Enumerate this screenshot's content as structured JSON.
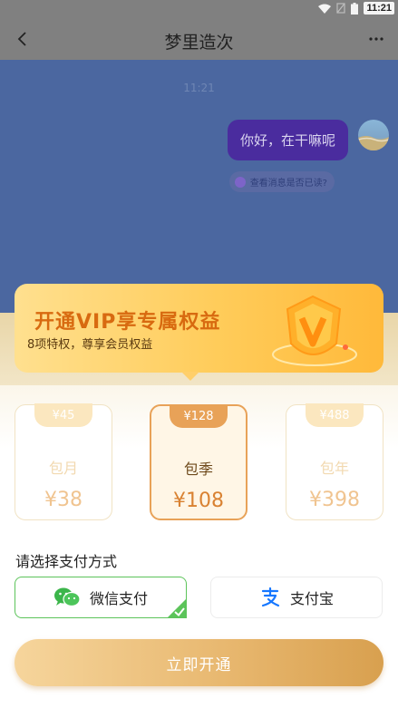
{
  "status_bar": {
    "time": "11:21"
  },
  "header": {
    "title": "梦里造次"
  },
  "chat": {
    "time_label": "11:21",
    "message": "你好，在干嘛呢",
    "read_check_label": "查看消息是否已读?"
  },
  "vip": {
    "title": "开通VIP享专属权益",
    "subtitle": "8项特权，尊享会员权益"
  },
  "plans": [
    {
      "original_price": "¥45",
      "name": "包月",
      "price": "¥38",
      "selected": false
    },
    {
      "original_price": "¥128",
      "name": "包季",
      "price": "¥108",
      "selected": true
    },
    {
      "original_price": "¥488",
      "name": "包年",
      "price": "¥398",
      "selected": false
    }
  ],
  "payment": {
    "label": "请选择支付方式",
    "options": [
      {
        "name": "微信支付",
        "icon": "wechat-icon",
        "selected": true
      },
      {
        "name": "支付宝",
        "icon": "alipay-icon",
        "selected": false
      }
    ]
  },
  "cta_label": "立即开通",
  "colors": {
    "accent_gold": "#e8a258",
    "wechat_green": "#5cc45a",
    "alipay_blue": "#1677ff",
    "overlay_blue": "#4b67a0"
  }
}
